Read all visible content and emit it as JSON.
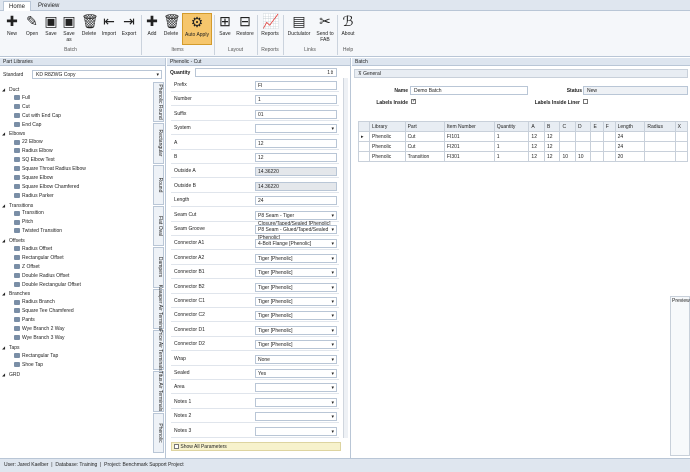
{
  "tabs": [
    "Home",
    "Preview"
  ],
  "ribbon": {
    "buttons": [
      {
        "label": "New",
        "icon": "new-icon"
      },
      {
        "label": "Open",
        "icon": "open-icon"
      },
      {
        "label": "Save",
        "icon": "save-icon"
      },
      {
        "label": "Save as",
        "icon": "save-as-icon"
      },
      {
        "label": "Delete",
        "icon": "delete-icon"
      },
      {
        "label": "Import",
        "icon": "import-icon"
      },
      {
        "label": "Export",
        "icon": "export-icon"
      },
      {
        "label": "Add",
        "icon": "add-icon"
      },
      {
        "label": "Delete",
        "icon": "delete-icon"
      },
      {
        "label": "Auto Apply",
        "icon": "auto-apply-icon"
      },
      {
        "label": "Save",
        "icon": "layout-save-icon"
      },
      {
        "label": "Restore",
        "icon": "restore-icon"
      },
      {
        "label": "Reports",
        "icon": "reports-icon"
      },
      {
        "label": "Ductulator",
        "icon": "ductulator-icon"
      },
      {
        "label": "Send to FAB",
        "icon": "send-to-fab-icon"
      },
      {
        "label": "About",
        "icon": "about-icon"
      }
    ],
    "groups": [
      "Batch",
      "Items",
      "Layout",
      "Reports",
      "Links",
      "Help"
    ]
  },
  "left": {
    "header": "Part Libraries",
    "library_label": "Standard",
    "library_value": "KD R8ZWG Copy",
    "tree": [
      {
        "label": "Duct",
        "level": 0
      },
      {
        "label": "Full",
        "level": 1
      },
      {
        "label": "Cut",
        "level": 1
      },
      {
        "label": "Cut with End Cap",
        "level": 1
      },
      {
        "label": "End Cap",
        "level": 1
      },
      {
        "label": "Elbows",
        "level": 0
      },
      {
        "label": "22 Elbow",
        "level": 1
      },
      {
        "label": "Radius Elbow",
        "level": 1
      },
      {
        "label": "SQ Elbow Test",
        "level": 1
      },
      {
        "label": "Square Throat Radius Elbow",
        "level": 1
      },
      {
        "label": "Square Elbow",
        "level": 1
      },
      {
        "label": "Square Elbow Chamfered",
        "level": 1
      },
      {
        "label": "Radius Parker",
        "level": 1
      },
      {
        "label": "Transitions",
        "level": 0
      },
      {
        "label": "Transition",
        "level": 1
      },
      {
        "label": "Pitch",
        "level": 1
      },
      {
        "label": "Twisted Transition",
        "level": 1
      },
      {
        "label": "Offsets",
        "level": 0
      },
      {
        "label": "Radius Offset",
        "level": 1
      },
      {
        "label": "Rectangular Offset",
        "level": 1
      },
      {
        "label": "Z Offset",
        "level": 1
      },
      {
        "label": "Double Radius Offset",
        "level": 1
      },
      {
        "label": "Double Rectangular Offset",
        "level": 1
      },
      {
        "label": "Branches",
        "level": 0
      },
      {
        "label": "Radius Branch",
        "level": 1
      },
      {
        "label": "Square Tee Chamfered",
        "level": 1
      },
      {
        "label": "Pants",
        "level": 1
      },
      {
        "label": "Wye Branch 2 Way",
        "level": 1
      },
      {
        "label": "Wye Branch 3 Way",
        "level": 1
      },
      {
        "label": "Taps",
        "level": 0
      },
      {
        "label": "Rectangular Tap",
        "level": 1
      },
      {
        "label": "Shoe Tap",
        "level": 1
      },
      {
        "label": "GRD",
        "level": 0
      }
    ],
    "vtabs": [
      "Phenolic Round",
      "Rectangular",
      "Round",
      "Flat Oval",
      "Dampers",
      "Kuaaper Air Terminals",
      "Price Air Terminals",
      "Titus Air Terminals",
      "Phenolic"
    ]
  },
  "mid": {
    "header": "Phenolic - Cut",
    "quantity_label": "Quantity",
    "quantity_value": "1",
    "fields": [
      {
        "label": "Prefix",
        "value": "FI",
        "kind": "text"
      },
      {
        "label": "Number",
        "value": "1",
        "kind": "text"
      },
      {
        "label": "Suffix",
        "value": "01",
        "kind": "text"
      },
      {
        "label": "System",
        "value": "",
        "kind": "select"
      },
      {
        "label": "A",
        "value": "12",
        "kind": "text"
      },
      {
        "label": "B",
        "value": "12",
        "kind": "text"
      },
      {
        "label": "Outside A",
        "value": "14.36220",
        "kind": "ro"
      },
      {
        "label": "Outside B",
        "value": "14.36220",
        "kind": "ro"
      },
      {
        "label": "Length",
        "value": "24",
        "kind": "text"
      },
      {
        "label": "Seam Cut",
        "value": "P8 Seam - Tiger Closure/Taped/Sealed [Phenolic]",
        "kind": "select"
      },
      {
        "label": "Seam Groove",
        "value": "P8 Seam - Glued/Taped/Sealed [Phenolic]",
        "kind": "select"
      },
      {
        "label": "Connector A1",
        "value": "4-Bolt Flange [Phenolic]",
        "kind": "select"
      },
      {
        "label": "Connector A2",
        "value": "Tiger [Phenolic]",
        "kind": "select"
      },
      {
        "label": "Connector B1",
        "value": "Tiger [Phenolic]",
        "kind": "select"
      },
      {
        "label": "Connector B2",
        "value": "Tiger [Phenolic]",
        "kind": "select"
      },
      {
        "label": "Connector C1",
        "value": "Tiger [Phenolic]",
        "kind": "select"
      },
      {
        "label": "Connector C2",
        "value": "Tiger [Phenolic]",
        "kind": "select"
      },
      {
        "label": "Connector D1",
        "value": "Tiger [Phenolic]",
        "kind": "select"
      },
      {
        "label": "Connector D2",
        "value": "Tiger [Phenolic]",
        "kind": "select"
      },
      {
        "label": "Wrap",
        "value": "None",
        "kind": "select"
      },
      {
        "label": "Sealed",
        "value": "Yes",
        "kind": "select"
      },
      {
        "label": "Area",
        "value": "",
        "kind": "select"
      },
      {
        "label": "Notes 1",
        "value": "",
        "kind": "select"
      },
      {
        "label": "Notes 2",
        "value": "",
        "kind": "select"
      },
      {
        "label": "Notes 3",
        "value": "",
        "kind": "select"
      }
    ],
    "show_all": "Show All Parameters"
  },
  "right": {
    "header": "Batch",
    "general": "General",
    "name_label": "Name",
    "name_value": "Demo Batch",
    "status_label": "Status",
    "status_value": "New",
    "labels_inside": "Labels Inside",
    "labels_inside_liner": "Labels Inside Liner",
    "preview": "Preview",
    "columns": [
      "Library",
      "Part",
      "Item Number",
      "Quantity",
      "A",
      "B",
      "C",
      "D",
      "E",
      "F",
      "Length",
      "Radius",
      "X"
    ],
    "rows": [
      [
        "Phenolic",
        "Cut",
        "FI101",
        "1",
        "12",
        "12",
        "",
        "",
        "",
        "",
        "24",
        "",
        ""
      ],
      [
        "Phenolic",
        "Cut",
        "FI201",
        "1",
        "12",
        "12",
        "",
        "",
        "",
        "",
        "24",
        "",
        ""
      ],
      [
        "Phenolic",
        "Transition",
        "FI301",
        "1",
        "12",
        "12",
        "10",
        "10",
        "",
        "",
        "20",
        "",
        ""
      ]
    ]
  },
  "status": {
    "user": "User: Jared Kaelber",
    "database": "Database: Training",
    "project": "Project: Benchmark Support Project"
  }
}
